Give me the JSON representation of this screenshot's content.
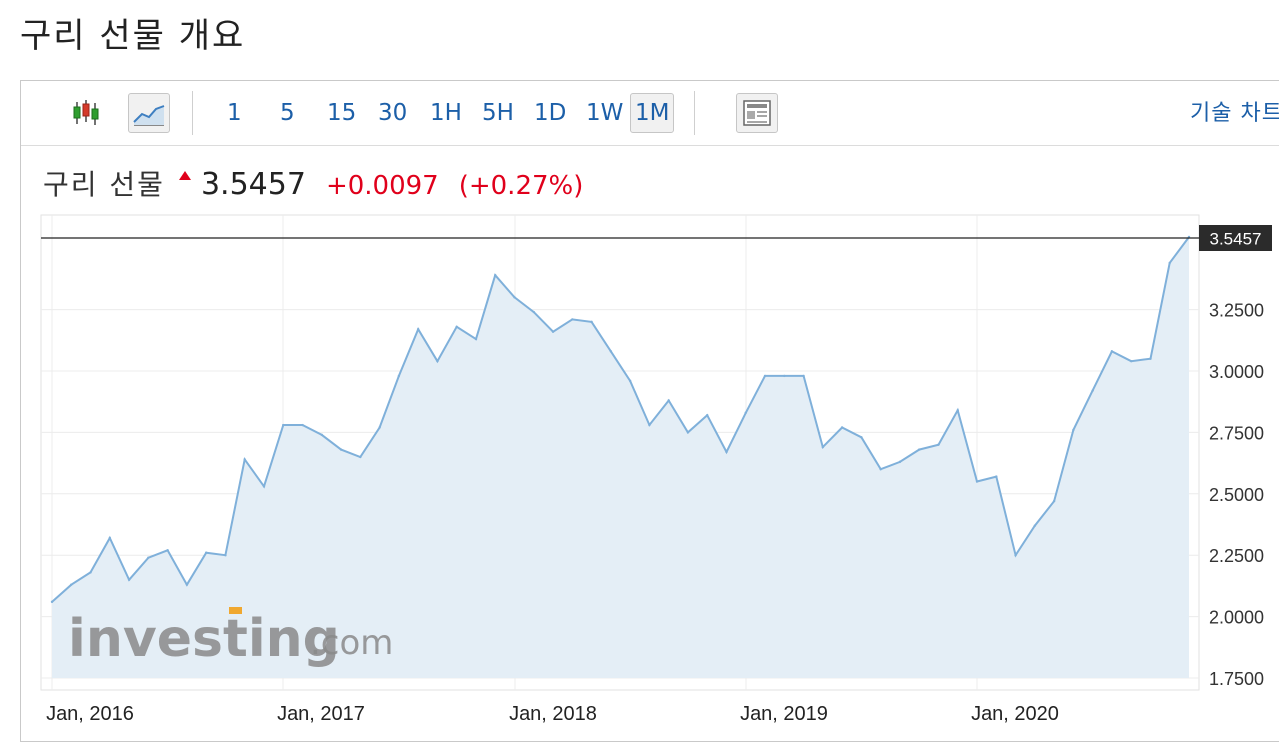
{
  "page_title": "구리 선물 개요",
  "toolbar": {
    "intervals": [
      {
        "label": "1",
        "active": false
      },
      {
        "label": "5",
        "active": false
      },
      {
        "label": "15",
        "active": false
      },
      {
        "label": "30",
        "active": false
      },
      {
        "label": "1H",
        "active": false
      },
      {
        "label": "5H",
        "active": false
      },
      {
        "label": "1D",
        "active": false
      },
      {
        "label": "1W",
        "active": false
      },
      {
        "label": "1M",
        "active": true
      }
    ],
    "icons": [
      "candlestick-icon",
      "line-chart-icon",
      "news-panel-icon"
    ],
    "tech_chart_label": "기술 차트"
  },
  "quote": {
    "name": "구리 선물",
    "price": "3.5457",
    "change": "+0.0097",
    "change_pct": "(+0.27%)",
    "direction": "up"
  },
  "colors": {
    "line": "#7fb0da",
    "area": "#e4eef6",
    "up": "#e0001b",
    "link": "#1c5fa8",
    "price_tag_bg": "#2b2b2b"
  },
  "watermark": {
    "brand": "investing",
    "suffix": ".com"
  },
  "chart_data": {
    "type": "area",
    "x_labels": [
      "Jan, 2016",
      "Jan, 2017",
      "Jan, 2018",
      "Jan, 2019",
      "Jan, 2020"
    ],
    "y_ticks": [
      "3.2500",
      "3.0000",
      "2.7500",
      "2.5000",
      "2.2500",
      "2.0000",
      "1.7500"
    ],
    "ylim": [
      1.75,
      3.55
    ],
    "last_value_label": "3.5457",
    "grid": true,
    "series": [
      {
        "values": [
          2.06,
          2.13,
          2.18,
          2.32,
          2.15,
          2.24,
          2.27,
          2.13,
          2.26,
          2.25,
          2.64,
          2.53,
          2.78,
          2.78,
          2.74,
          2.68,
          2.65,
          2.77,
          2.98,
          3.17,
          3.04,
          3.18,
          3.13,
          3.39,
          3.3,
          3.24,
          3.16,
          3.21,
          3.2,
          3.08,
          2.96,
          2.78,
          2.88,
          2.75,
          2.82,
          2.67,
          2.83,
          2.98,
          2.98,
          2.98,
          2.69,
          2.77,
          2.73,
          2.6,
          2.63,
          2.68,
          2.7,
          2.84,
          2.55,
          2.57,
          2.25,
          2.37,
          2.47,
          2.76,
          2.92,
          3.08,
          3.04,
          3.05,
          3.44,
          3.5457
        ]
      }
    ]
  }
}
